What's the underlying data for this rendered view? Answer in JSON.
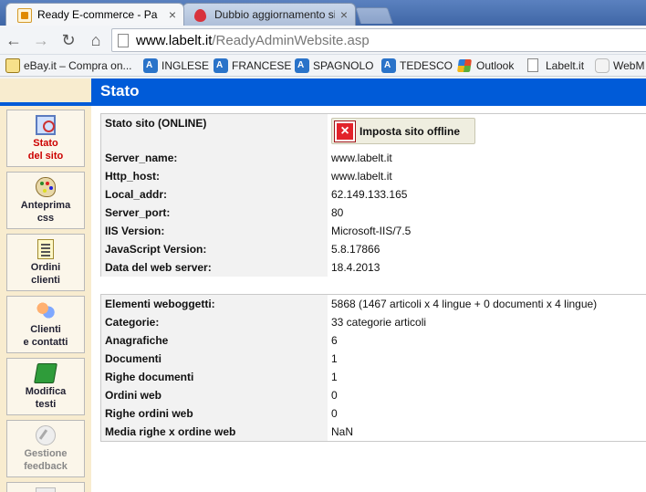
{
  "browser": {
    "tabs": [
      {
        "title": "Ready E-commerce - Pann",
        "active": true
      },
      {
        "title": "Dubbio aggiornamento si",
        "active": false
      }
    ],
    "close_glyph": "×",
    "url": {
      "host": "www.labelt.it",
      "path": "/ReadyAdminWebsite.asp"
    },
    "bookmarks": [
      {
        "label": "eBay.it – Compra on...",
        "icon": "shopping-bag-icon"
      },
      {
        "label": "INGLESE",
        "icon": "translate-icon"
      },
      {
        "label": "FRANCESE",
        "icon": "translate-icon"
      },
      {
        "label": "SPAGNOLO",
        "icon": "translate-icon"
      },
      {
        "label": "TEDESCO",
        "icon": "translate-icon"
      },
      {
        "label": "Outlook",
        "icon": "windows-logo-icon"
      },
      {
        "label": "Labelt.it",
        "icon": "page-icon"
      },
      {
        "label": "WebM",
        "icon": "hand-icon"
      }
    ]
  },
  "page": {
    "title": "Stato",
    "accent_color": "#005bd8",
    "sidebar_color": "#f8eccf"
  },
  "sidebar": {
    "items": [
      {
        "label": "Stato\ndel sito",
        "state": "active",
        "icon": "status-monitor-icon"
      },
      {
        "label": "Anteprima\ncss",
        "state": "normal",
        "icon": "palette-icon"
      },
      {
        "label": "Ordini\nclienti",
        "state": "normal",
        "icon": "order-list-icon"
      },
      {
        "label": "Clienti\ne contatti",
        "state": "normal",
        "icon": "users-icon"
      },
      {
        "label": "Modifica\ntesti",
        "state": "normal",
        "icon": "book-icon"
      },
      {
        "label": "Gestione\nfeedback",
        "state": "disabled",
        "icon": "feedback-pen-icon"
      }
    ]
  },
  "status": {
    "site_label": "Stato sito (ONLINE)",
    "offline_button": "Imposta sito offline",
    "rows": [
      {
        "key": "Server_name:",
        "value": "www.labelt.it"
      },
      {
        "key": "Http_host:",
        "value": "www.labelt.it"
      },
      {
        "key": "Local_addr:",
        "value": "62.149.133.165"
      },
      {
        "key": "Server_port:",
        "value": "80"
      },
      {
        "key": "IIS Version:",
        "value": "Microsoft-IIS/7.5"
      },
      {
        "key": "JavaScript Version:",
        "value": "5.8.17866"
      },
      {
        "key": "Data del web server:",
        "value": "18.4.2013"
      }
    ]
  },
  "stats": {
    "rows": [
      {
        "key": "Elementi weboggetti:",
        "value": "5868 (1467 articoli x 4 lingue + 0 documenti x 4 lingue)"
      },
      {
        "key": "Categorie:",
        "value": "33 categorie articoli"
      },
      {
        "key": "Anagrafiche",
        "value": "6"
      },
      {
        "key": "Documenti",
        "value": "1"
      },
      {
        "key": "Righe documenti",
        "value": "1"
      },
      {
        "key": "Ordini web",
        "value": "0"
      },
      {
        "key": "Righe ordini web",
        "value": "0"
      },
      {
        "key": "Media righe x ordine web",
        "value": "NaN"
      }
    ]
  }
}
